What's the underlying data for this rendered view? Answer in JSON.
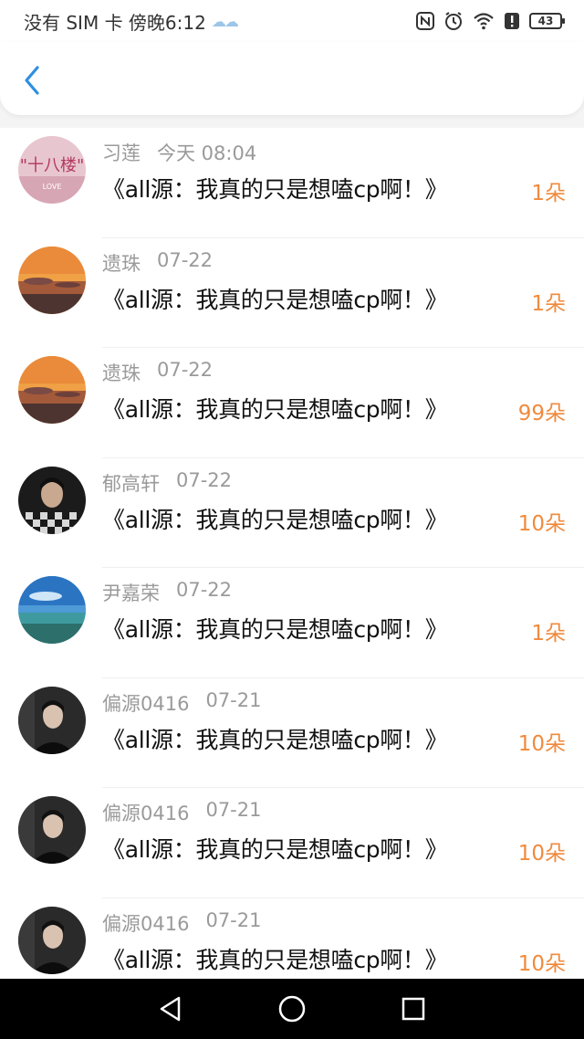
{
  "status_bar": {
    "carrier": "没有 SIM 卡 傍晚6:12",
    "weather": "☁☁",
    "battery": "43"
  },
  "header": {
    "back_icon": "chevron-left-icon"
  },
  "colors": {
    "accent": "#f08a3c",
    "back": "#2f8fe0"
  },
  "items": [
    {
      "name": "习莲",
      "time": "今天 08:04",
      "message": "《all源：我真的只是想嗑cp啊！》",
      "amount": "1朵",
      "avatar": "pink-poster"
    },
    {
      "name": "遗珠",
      "time": "07-22",
      "message": "《all源：我真的只是想嗑cp啊！》",
      "amount": "1朵",
      "avatar": "sunset"
    },
    {
      "name": "遗珠",
      "time": "07-22",
      "message": "《all源：我真的只是想嗑cp啊！》",
      "amount": "99朵",
      "avatar": "sunset"
    },
    {
      "name": "郁高轩",
      "time": "07-22",
      "message": "《all源：我真的只是想嗑cp啊！》",
      "amount": "10朵",
      "avatar": "portrait-checker"
    },
    {
      "name": "尹嘉荣",
      "time": "07-22",
      "message": "《all源：我真的只是想嗑cp啊！》",
      "amount": "1朵",
      "avatar": "ocean"
    },
    {
      "name": "偏源0416",
      "time": "07-21",
      "message": "《all源：我真的只是想嗑cp啊！》",
      "amount": "10朵",
      "avatar": "portrait-dark"
    },
    {
      "name": "偏源0416",
      "time": "07-21",
      "message": "《all源：我真的只是想嗑cp啊！》",
      "amount": "10朵",
      "avatar": "portrait-dark"
    },
    {
      "name": "偏源0416",
      "time": "07-21",
      "message": "《all源：我真的只是想嗑cp啊！》",
      "amount": "10朵",
      "avatar": "portrait-dark"
    }
  ],
  "navbar": {
    "back": "triangle-back-icon",
    "home": "circle-home-icon",
    "recents": "square-recents-icon"
  }
}
